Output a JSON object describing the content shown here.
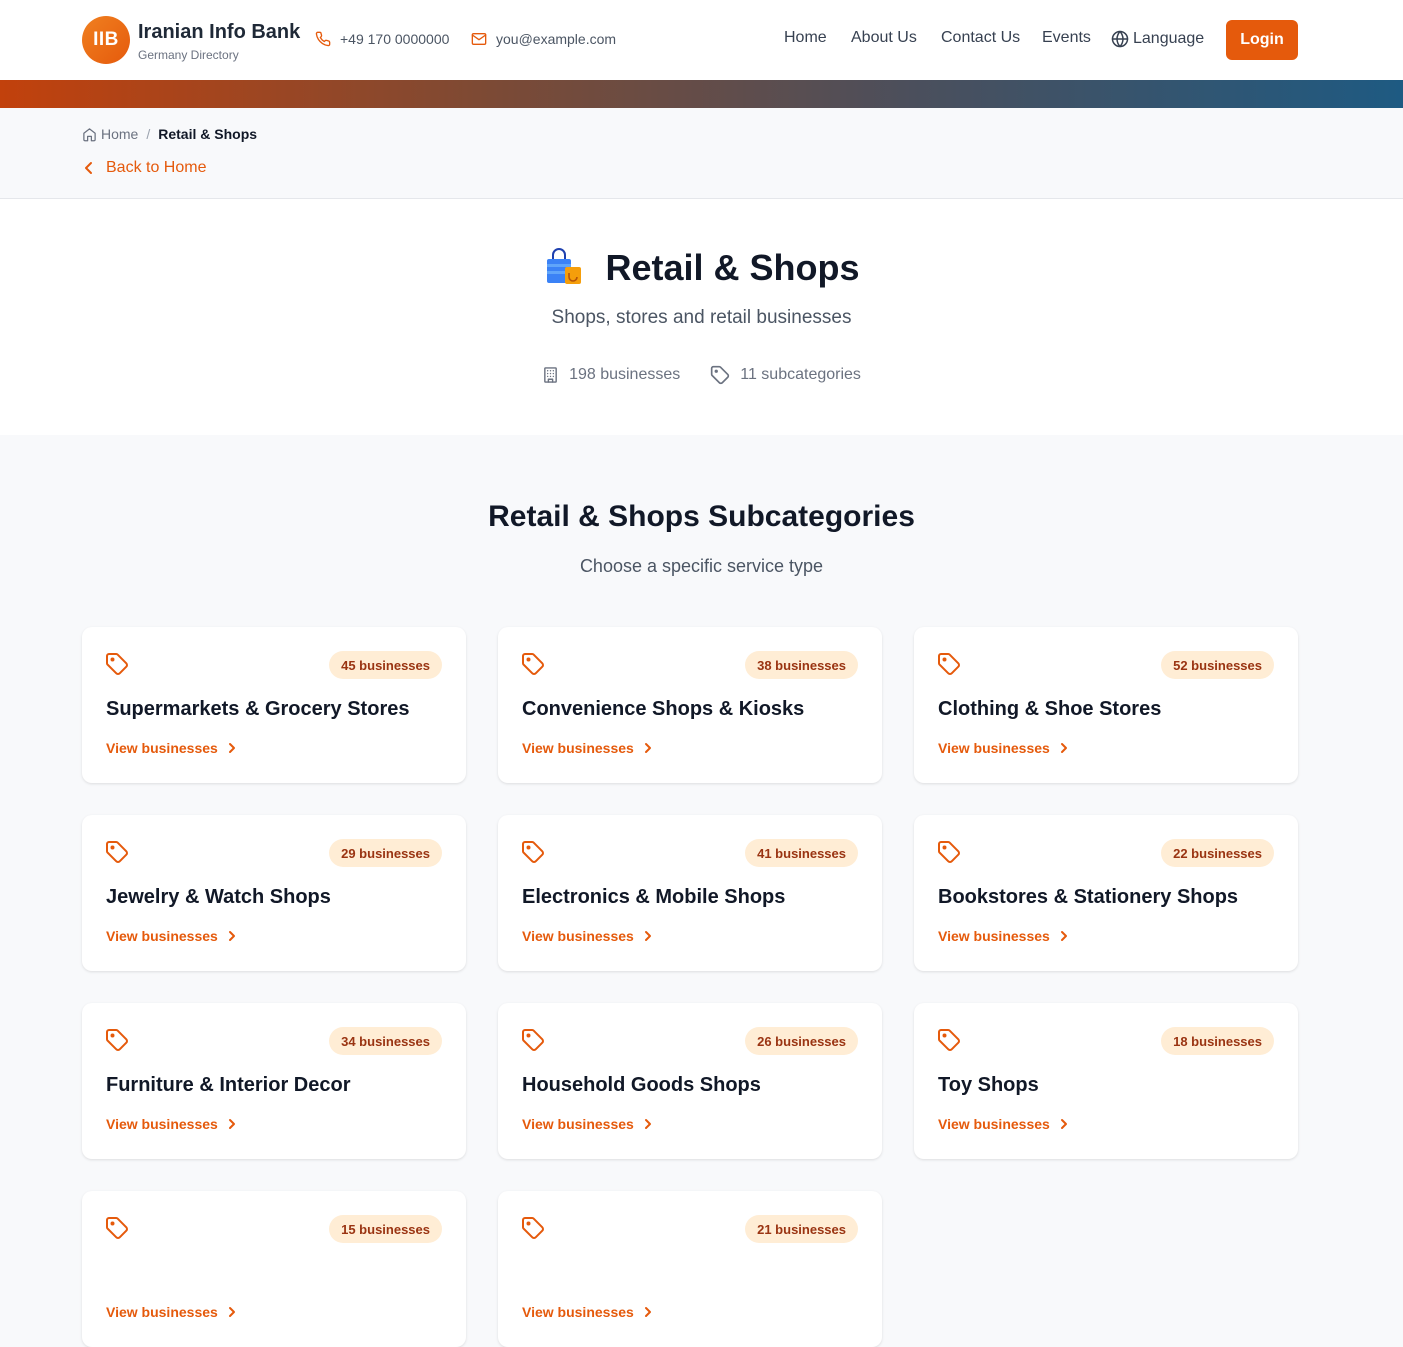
{
  "header": {
    "logo_text": "IIB",
    "brand_name": "Iranian Info Bank",
    "brand_sub": "Germany Directory",
    "phone": "+49 170 0000000",
    "email": "you@example.com",
    "nav": {
      "home": "Home",
      "about": "About Us",
      "contact": "Contact Us",
      "events": "Events",
      "language": "Language"
    },
    "login_label": "Login"
  },
  "breadcrumb": {
    "home": "Home",
    "separator": "/",
    "current": "Retail & Shops",
    "back": "Back to Home"
  },
  "hero": {
    "title": "Retail & Shops",
    "description": "Shops, stores and retail businesses",
    "businesses": "198 businesses",
    "subcategories": "11 subcategories"
  },
  "subcategories_section": {
    "title": "Retail & Shops Subcategories",
    "description": "Choose a specific service type",
    "link_label": "View businesses",
    "cards": [
      {
        "title": "Supermarkets & Grocery Stores",
        "count": "45 businesses"
      },
      {
        "title": "Convenience Shops & Kiosks",
        "count": "38 businesses"
      },
      {
        "title": "Clothing & Shoe Stores",
        "count": "52 businesses"
      },
      {
        "title": "Jewelry & Watch Shops",
        "count": "29 businesses"
      },
      {
        "title": "Electronics & Mobile Shops",
        "count": "41 businesses"
      },
      {
        "title": "Bookstores & Stationery Shops",
        "count": "22 businesses"
      },
      {
        "title": "Furniture & Interior Decor",
        "count": "34 businesses"
      },
      {
        "title": "Household Goods Shops",
        "count": "26 businesses"
      },
      {
        "title": "Toy Shops",
        "count": "18 businesses"
      },
      {
        "title": "",
        "count": "15 businesses"
      },
      {
        "title": "",
        "count": "21 businesses"
      }
    ]
  },
  "colors": {
    "accent": "#e55a0c",
    "badge_bg": "#ffedd5",
    "badge_text": "#9a3412"
  }
}
